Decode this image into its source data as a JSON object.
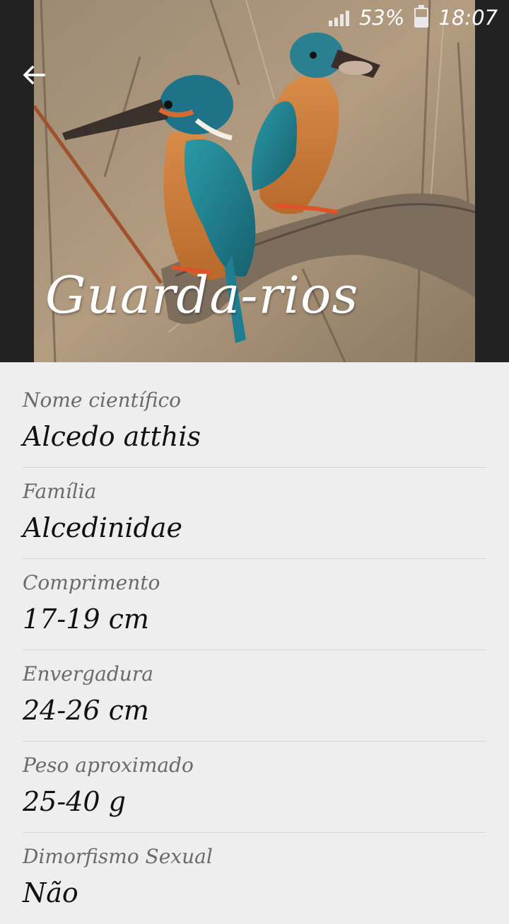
{
  "status_bar": {
    "battery": "53%",
    "time": "18:07"
  },
  "header": {
    "title": "Guarda-rios",
    "back_icon": "arrow-left-icon",
    "photo": "kingfisher-pair-photo"
  },
  "details": [
    {
      "label": "Nome científico",
      "value": "Alcedo atthis"
    },
    {
      "label": "Família",
      "value": "Alcedinidae"
    },
    {
      "label": "Comprimento",
      "value": "17-19 cm"
    },
    {
      "label": "Envergadura",
      "value": "24-26 cm"
    },
    {
      "label": "Peso aproximado",
      "value": "25-40 g"
    },
    {
      "label": "Dimorfismo Sexual",
      "value": "Não"
    }
  ],
  "colors": {
    "header_background": "#222222",
    "page_background": "#eeeeee",
    "label_color": "#6a6a6a",
    "value_color": "#111111",
    "divider": "#d6d6d6"
  }
}
